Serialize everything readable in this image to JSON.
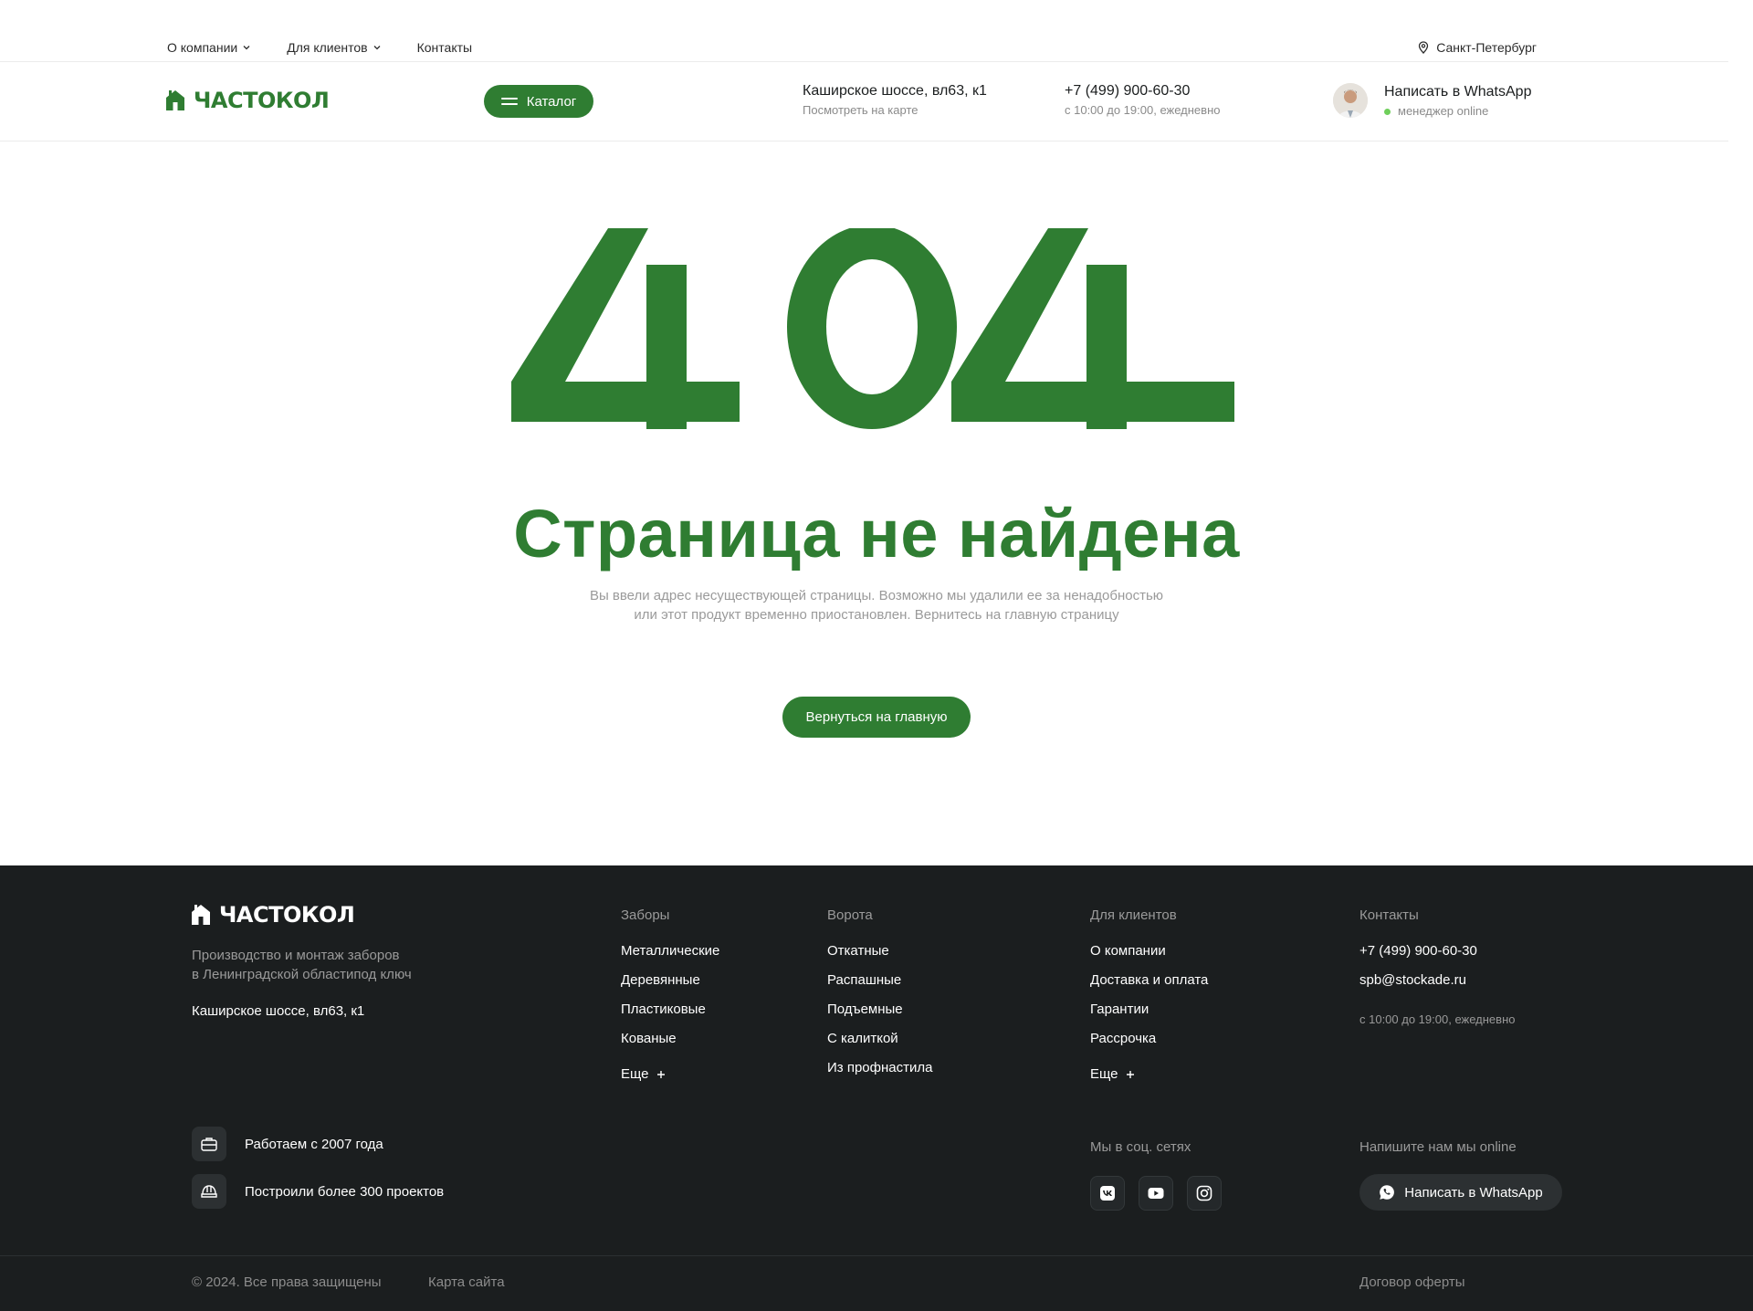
{
  "topnav": {
    "items": [
      {
        "label": "О компании",
        "has_dropdown": true
      },
      {
        "label": "Для клиентов",
        "has_dropdown": true
      },
      {
        "label": "Контакты",
        "has_dropdown": false
      }
    ],
    "city": "Санкт-Петербург"
  },
  "header": {
    "logo_text": "ЧАСТОКОЛ",
    "catalog_label": "Каталог",
    "address": "Каширское шоссе, вл63, к1",
    "address_sub": "Посмотреть на карте",
    "phone": "+7 (499) 900-60-30",
    "phone_sub": "с 10:00 до 19:00, ежедневно",
    "whatsapp_label": "Написать в WhatsApp",
    "whatsapp_sub": "менеджер online"
  },
  "error": {
    "code": "404",
    "title": "Страница не найдена",
    "desc_line1": "Вы ввели адрес несуществующей страницы. Возможно мы удалили ее за ненадобностью",
    "desc_line2": "или этот продукт временно приостановлен. Вернитесь на главную страницу",
    "home_button": "Вернуться на главную"
  },
  "footer": {
    "logo_text": "ЧАСТОКОЛ",
    "tagline_line1": "Производство и монтаж заборов",
    "tagline_line2": "в Ленинградской областипод ключ",
    "address": "Каширское шоссе, вл63, к1",
    "fences": {
      "heading": "Заборы",
      "items": [
        "Металлические",
        "Деревянные",
        "Пластиковые",
        "Кованые"
      ],
      "more": "Еще"
    },
    "gates": {
      "heading": "Ворота",
      "items": [
        "Откатные",
        "Распашные",
        "Подъемные",
        "С калиткой",
        "Из профнастила"
      ]
    },
    "clients": {
      "heading": "Для клиентов",
      "items": [
        "О компании",
        "Доставка и оплата",
        "Гарантии",
        "Рассрочка"
      ],
      "more": "Еще"
    },
    "contacts": {
      "heading": "Контакты",
      "phone": "+7 (499) 900-60-30",
      "email": "spb@stockade.ru",
      "hours": "с 10:00 до 19:00, ежедневно"
    },
    "badges": [
      "Работаем с 2007 года",
      "Построили более 300 проектов"
    ],
    "social_heading": "Мы в соц. сетях",
    "socials": [
      "vk-icon",
      "youtube-icon",
      "instagram-icon"
    ],
    "online_heading": "Напишите нам мы online",
    "whatsapp_button": "Написать в WhatsApp",
    "copyright": "© 2024. Все права защищены",
    "sitemap": "Карта сайта",
    "offer": "Договор оферты"
  },
  "colors": {
    "brand_green": "#2f7d32",
    "footer_bg": "#1b1e1f",
    "online_dot": "#6fcf5b"
  }
}
